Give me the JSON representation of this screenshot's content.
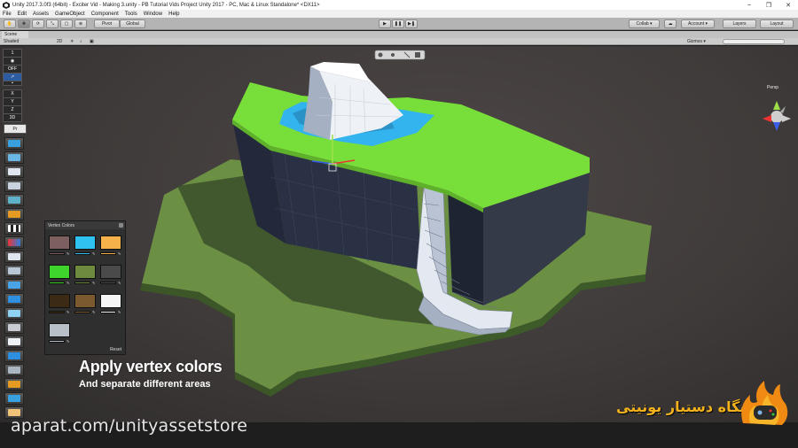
{
  "window": {
    "title": "Unity 2017.3.0f3 (64bit) - Exciter Vid - Making 3.unity - PB Tutorial Vids Project Unity 2017 - PC, Mac & Linux Standalone* <DX11>",
    "controls": [
      "–",
      "❐",
      "✕"
    ]
  },
  "menu": [
    "File",
    "Edit",
    "Assets",
    "GameObject",
    "Component",
    "Tools",
    "Window",
    "Help"
  ],
  "toolbar": {
    "pivot_label": "Pivot",
    "global_label": "Global",
    "collab_label": "Collab ▾",
    "account_label": "Account ▾",
    "layers_label": "Layers",
    "layout_label": "Layout"
  },
  "scene": {
    "tab_label": "Scene",
    "shading_label": "Shaded",
    "mode_2d": "2D",
    "gizmos_label": "Gizmos ▾",
    "persp_label": "Persp"
  },
  "left_strip": {
    "items": [
      "1",
      "◉",
      "OFF",
      "↗",
      "",
      "X",
      "Y",
      "Z",
      "3D"
    ]
  },
  "probuilder_tab": "Pr",
  "vertex_colors": {
    "title": "Vertex Colors",
    "reset_label": "Reset",
    "swatches": [
      {
        "color": "#7e5f5f",
        "bar": "#7e5f5f"
      },
      {
        "color": "#2fc1f0",
        "bar": "#2fc1f0"
      },
      {
        "color": "#f6b14a",
        "bar": "#f6b14a"
      },
      {
        "color": "#3fd42c",
        "bar": "#3fd42c"
      },
      {
        "color": "#6e8a3e",
        "bar": "#6e8a3e"
      },
      {
        "color": "#4a4a4a",
        "bar": "#4a4a4a"
      },
      {
        "color": "#3c2b14",
        "bar": "#3c2b14"
      },
      {
        "color": "#7b5a30",
        "bar": "#7b5a30"
      },
      {
        "color": "#f5f5f5",
        "bar": "#f5f5f5"
      },
      {
        "color": "#b9c0c8",
        "bar": "#b9c0c8"
      }
    ]
  },
  "caption": {
    "title": "Apply vertex colors",
    "subtitle": "And separate different areas"
  },
  "watermark": {
    "site": "aparat.com/unityassetstore",
    "brand_fa": "فروشگاه دستیار یونیتی"
  },
  "colors": {
    "grass": "#79e03a",
    "ground": "#6e8f45",
    "rock": "#2a2f3d",
    "water": "#3ab6ef",
    "accent": "#f3b21b"
  }
}
